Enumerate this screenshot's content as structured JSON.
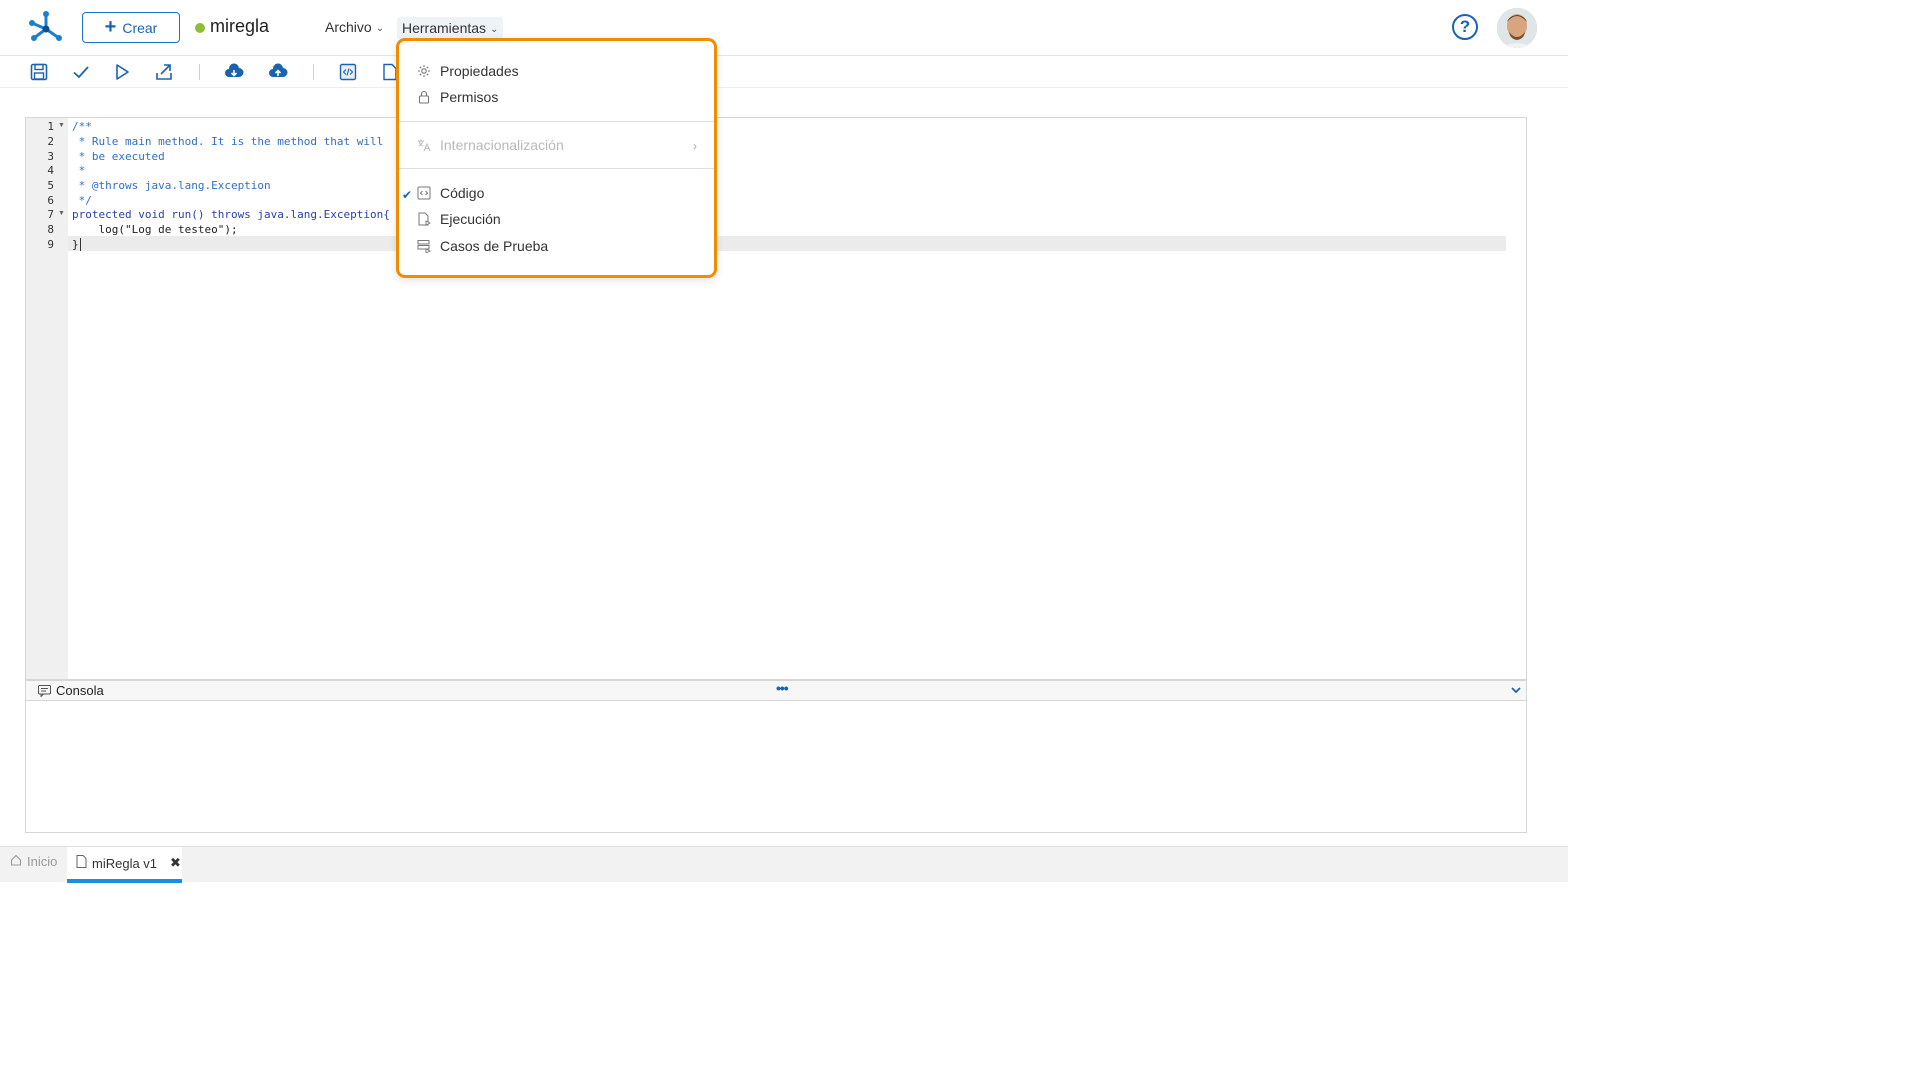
{
  "header": {
    "create_label": "Crear",
    "doc_title": "miregla",
    "status_color": "#8fbd3a",
    "menus": {
      "archivo": "Archivo",
      "herramientas": "Herramientas"
    },
    "help_icon": "question-circle-icon"
  },
  "toolbar": {
    "icons": [
      "save-icon",
      "check-icon",
      "play-icon",
      "export-icon",
      "cloud-download-icon",
      "cloud-upload-icon",
      "code-view-icon",
      "execution-view-icon"
    ]
  },
  "editor": {
    "line_numbers": [
      "1",
      "2",
      "3",
      "4",
      "5",
      "6",
      "7",
      "8",
      "9"
    ],
    "lines": [
      "/**",
      " * Rule main method. It is the method that will",
      " * be executed",
      " *",
      " * @throws java.lang.Exception",
      " */",
      "protected void run() throws java.lang.Exception{",
      "    log(\"Log de testeo\");",
      "}"
    ],
    "active_line": 9
  },
  "console": {
    "title": "Consola",
    "dots": "•••"
  },
  "dropdown": {
    "items": [
      {
        "label": "Propiedades",
        "icon": "gear-icon",
        "enabled": true,
        "checked": false
      },
      {
        "label": "Permisos",
        "icon": "lock-icon",
        "enabled": true,
        "checked": false
      },
      {
        "label": "Internacionalización",
        "icon": "translate-icon",
        "enabled": false,
        "checked": false
      },
      {
        "label": "Código",
        "icon": "code-icon",
        "enabled": true,
        "checked": true
      },
      {
        "label": "Ejecución",
        "icon": "execution-icon",
        "enabled": true,
        "checked": false
      },
      {
        "label": "Casos de Prueba",
        "icon": "test-cases-icon",
        "enabled": true,
        "checked": false
      }
    ],
    "highlight_color": "#f08c00"
  },
  "bottom_tabs": {
    "home": "Inicio",
    "rule": "miRegla v1"
  },
  "colors": {
    "accent": "#1a63b0",
    "tab_active": "#1a8fe0"
  }
}
